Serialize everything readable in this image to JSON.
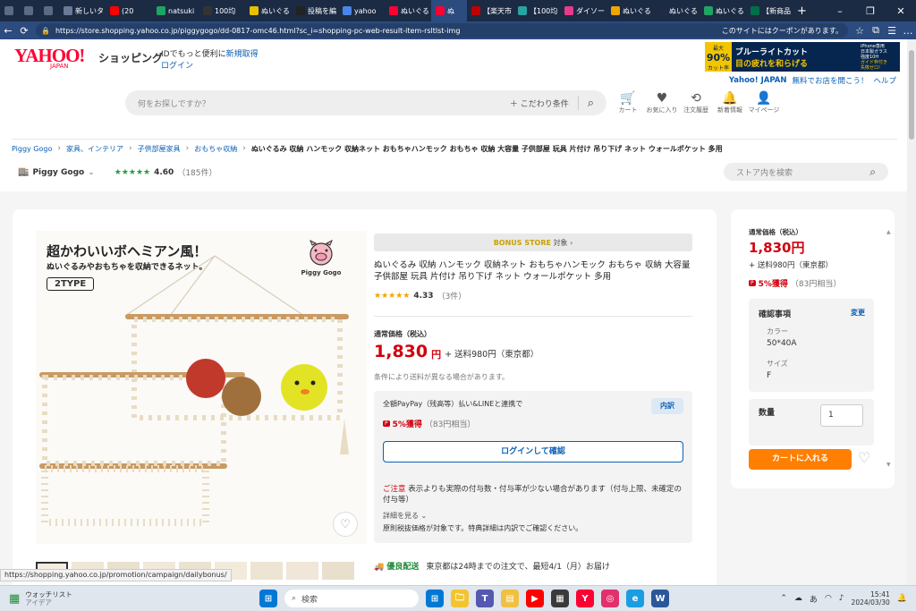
{
  "tabs": [
    {
      "label": "",
      "color": "#5b6b86"
    },
    {
      "label": "",
      "color": "#5b6b86"
    },
    {
      "label": "",
      "color": "#5b6b86"
    },
    {
      "label": "新しいタ",
      "color": "#6b7a95"
    },
    {
      "label": "(20",
      "color": "#ff0000"
    },
    {
      "label": "natsuki",
      "color": "#1fa463"
    },
    {
      "label": "100均",
      "color": "#333333"
    },
    {
      "label": "ぬいぐる",
      "color": "#e8c000"
    },
    {
      "label": "投稿を編",
      "color": "#222222"
    },
    {
      "label": "yahoo",
      "color": "#4a86e8"
    },
    {
      "label": "ぬいぐる",
      "color": "#ff0033"
    },
    {
      "label": "ぬ",
      "color": "#ff0033"
    },
    {
      "label": "【楽天市",
      "color": "#bf0000"
    },
    {
      "label": "【100均",
      "color": "#29a3a3"
    },
    {
      "label": "ダイソー",
      "color": "#e83a8c"
    },
    {
      "label": "ぬいぐる",
      "color": "#f0a500"
    },
    {
      "label": "ぬいぐる",
      "color": "#1f2a44"
    },
    {
      "label": "ぬいぐる",
      "color": "#1fa463"
    },
    {
      "label": "【新商品",
      "color": "#00704a"
    }
  ],
  "browser": {
    "url": "https://store.shopping.yahoo.co.jp/piggygogo/dd-0817-omc46.html?sc_i=shopping-pc-web-result-item-rsltlst-img",
    "coupon_notice": "このサイトにはクーポンがあります。"
  },
  "header": {
    "logo": "YAHOO!",
    "logo_sub": "JAPAN",
    "shopping": "ショッピング",
    "id_text": "IDでもっと便利に",
    "register": "新規取得",
    "login": "ログイン",
    "ad": {
      "line1": "最大",
      "pct": "90%",
      "line2": "カット率",
      "title1": "ブルーライトカット",
      "title2": "目の疲れを和らげる",
      "side1": "iPhone専用",
      "side2": "日本製ガラス",
      "side3": "強度10H",
      "side4": "ガイド枠付き",
      "side5": "失敗ゼロ!"
    },
    "top_links": [
      "Yahoo! JAPAN",
      "無料でお店を開こう！",
      "ヘルプ"
    ],
    "search_placeholder": "何をお探しですか？",
    "search_options": "こだわり条件",
    "icons": [
      {
        "label": "カート",
        "icon": "cart-icon",
        "g": "🛒"
      },
      {
        "label": "お気に入り",
        "icon": "heart-icon",
        "g": "♥"
      },
      {
        "label": "注文履歴",
        "icon": "history-icon",
        "g": "⟲"
      },
      {
        "label": "新着情報",
        "icon": "bell-icon",
        "g": "🔔"
      },
      {
        "label": "マイページ",
        "icon": "person-icon",
        "g": "👤"
      }
    ],
    "breadcrumb": [
      "Piggy Gogo",
      "家具、インテリア",
      "子供部屋家具",
      "おもちゃ収納"
    ],
    "breadcrumb_current": "ぬいぐるみ 収納 ハンモック 収納ネット おもちゃハンモック おもちゃ 収納 大容量 子供部屋 玩具 片付け 吊り下げ ネット ウォールポケット 多用",
    "store_name": "Piggy Gogo",
    "store_rating": "4.60",
    "store_reviews": "（185件）",
    "store_search_placeholder": "ストア内を検索"
  },
  "product": {
    "banner_line1": "超かわいいボヘミアン風！",
    "banner_line2": "ぬいぐるみやおもちゃを収納できるネット。",
    "badge": "2TYPE",
    "brand_logo": "Piggy Gogo",
    "bonus_store": "BONUS STORE",
    "bonus_suffix": "対象",
    "title": "ぬいぐるみ 収納 ハンモック 収納ネット おもちゃハンモック おもちゃ 収納 大容量 子供部屋 玩具 片付け 吊り下げ ネット ウォールポケット 多用",
    "rating": "4.33",
    "reviews": "（3件）",
    "rating_value": 4.33,
    "price_label": "通常価格（税込）",
    "price": "1,830",
    "yen": "円",
    "shipping": "+ 送料980円（東京都）",
    "note": "条件により送料が異なる場合があります。",
    "paypay": "全額PayPay（残高等）払い&LINEと連携で",
    "breakdown": "内訳",
    "points": "5%獲得",
    "points_detail": "（83円相当）",
    "login_confirm": "ログインして確認",
    "caution_label": "ご注意",
    "caution": "表示よりも実際の付与数・付与率が少ない場合があります（付与上限、未確定の付与等）",
    "details": "詳細を見る",
    "principle": "原則税抜価格が対象です。特典詳細は内訳でご確認ください。",
    "delivery_badge": "優良配送",
    "delivery": "東京都は24時までの注文で、最短4/1（月）お届け"
  },
  "sidebar": {
    "price_label": "通常価格（税込）",
    "price": "1,830円",
    "shipping": "+ 送料980円（東京都）",
    "points": "5%獲得",
    "points_detail": "（83円相当）",
    "confirm_title": "確認事項",
    "change": "変更",
    "color_label": "カラー",
    "color_value": "50*40A",
    "size_label": "サイズ",
    "size_value": "F",
    "qty_label": "数量",
    "qty_value": "1",
    "cart_button": "カートに入れる"
  },
  "status_url": "https://shopping.yahoo.co.jp/promotion/campaign/dailybonus/",
  "taskbar": {
    "weather_title": "ウォッチリスト",
    "weather_sub": "アイデア",
    "search": "検索",
    "time": "15:41",
    "date": "2024/03/30",
    "ime": "あ"
  },
  "taskbar_apps": [
    {
      "c": "#0078d4",
      "g": "⊞"
    },
    {
      "c": "#f4c430",
      "g": "🗀"
    },
    {
      "c": "#5558af",
      "g": "T"
    },
    {
      "c": "#f0c040",
      "g": "▤"
    },
    {
      "c": "#ff0000",
      "g": "▶"
    },
    {
      "c": "#3a3a3a",
      "g": "▦"
    },
    {
      "c": "#ff0033",
      "g": "Y"
    },
    {
      "c": "#e1306c",
      "g": "◎"
    },
    {
      "c": "#1b9de2",
      "g": "e"
    },
    {
      "c": "#2b579a",
      "g": "W"
    }
  ]
}
